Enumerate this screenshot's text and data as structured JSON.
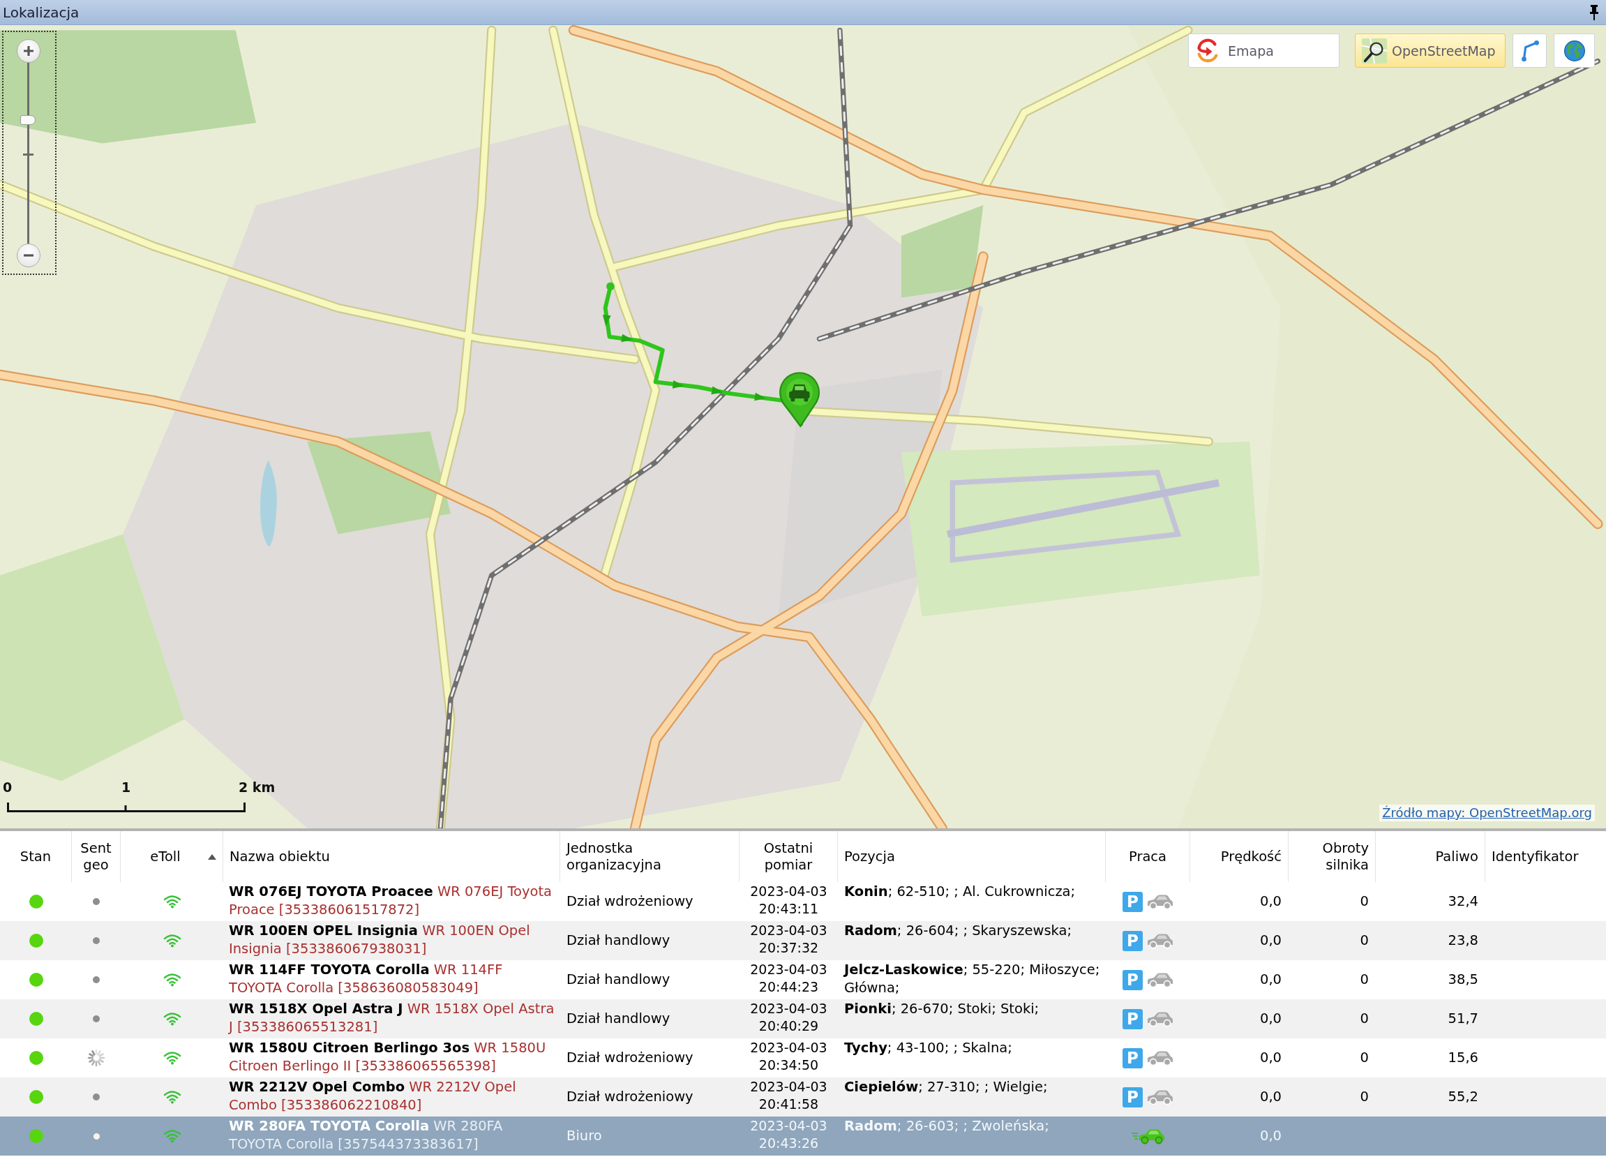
{
  "window": {
    "title": "Lokalizacja"
  },
  "map": {
    "sources": [
      {
        "label": "Emapa",
        "kind": "emapa",
        "selected": false
      },
      {
        "label": "OpenStreetMap",
        "kind": "osm",
        "selected": true
      }
    ],
    "zoom": {
      "level": 0.68
    },
    "scale": [
      "0",
      "1",
      "2 km"
    ],
    "attribution": "Źródło mapy: OpenStreetMap.org"
  },
  "table": {
    "columns": [
      {
        "label": "Stan",
        "sorted": false
      },
      {
        "label": "Sent geo",
        "sorted": false
      },
      {
        "label": "eToll",
        "sorted": true
      },
      {
        "label": "Nazwa obiektu",
        "sorted": false
      },
      {
        "label": "Jednostka organizacyjna",
        "sorted": false
      },
      {
        "label": "Ostatni pomiar",
        "sorted": false
      },
      {
        "label": "Pozycja",
        "sorted": false
      },
      {
        "label": "Praca",
        "sorted": false
      },
      {
        "label": "Prędkość",
        "sorted": false
      },
      {
        "label": "Obroty silnika",
        "sorted": false
      },
      {
        "label": "Paliwo",
        "sorted": false
      },
      {
        "label": "Identyfikator",
        "sorted": false
      }
    ],
    "rows": [
      {
        "online": true,
        "sent_geo": {
          "kind": "dot"
        },
        "etoll": true,
        "name": "**WR 076EJ TOYOTA Proacee** WR 076EJ Toyota Proace [353386061517872]",
        "unit": "Dział wdrożeniowy",
        "last_measurement": "2023-04-03 20:43:11",
        "position": "**Konin**; 62-510; ; Al. Cukrownicza;",
        "work": {
          "kind": "parked",
          "badge": "P"
        },
        "speed": "0,0",
        "rpm": "0",
        "fuel": "32,4",
        "selected": false
      },
      {
        "online": true,
        "sent_geo": {
          "kind": "dot"
        },
        "etoll": true,
        "name": "**WR 100EN OPEL Insignia** WR 100EN Opel Insignia [353386067938031]",
        "unit": "Dział handlowy",
        "last_measurement": "2023-04-03 20:37:32",
        "position": "**Radom**; 26-604; ; Skaryszewska;",
        "work": {
          "kind": "parked",
          "badge": "P"
        },
        "speed": "0,0",
        "rpm": "0",
        "fuel": "23,8",
        "selected": false
      },
      {
        "online": true,
        "sent_geo": {
          "kind": "dot"
        },
        "etoll": true,
        "name": "**WR 114FF TOYOTA Corolla** WR 114FF TOYOTA Corolla [358636080583049]",
        "unit": "Dział handlowy",
        "last_measurement": "2023-04-03 20:44:23",
        "position": "**Jelcz-Laskowice**; 55-220; Miłoszyce; Główna;",
        "work": {
          "kind": "parked",
          "badge": "P"
        },
        "speed": "0,0",
        "rpm": "0",
        "fuel": "38,5",
        "selected": false
      },
      {
        "online": true,
        "sent_geo": {
          "kind": "dot"
        },
        "etoll": true,
        "name": "**WR 1518X Opel Astra J** WR 1518X Opel Astra J [353386065513281]",
        "unit": "Dział handlowy",
        "last_measurement": "2023-04-03 20:40:29",
        "position": "**Pionki**; 26-670; Stoki; Stoki;",
        "work": {
          "kind": "parked",
          "badge": "P"
        },
        "speed": "0,0",
        "rpm": "0",
        "fuel": "51,7",
        "selected": false
      },
      {
        "online": true,
        "sent_geo": {
          "kind": "spinner"
        },
        "etoll": true,
        "name": "**WR 1580U Citroen Berlingo 3os** WR 1580U Citroen Berlingo II [353386065565398]",
        "unit": "Dział wdrożeniowy",
        "last_measurement": "2023-04-03 20:34:50",
        "position": "**Tychy**; 43-100; ; Skalna;",
        "work": {
          "kind": "parked",
          "badge": "P"
        },
        "speed": "0,0",
        "rpm": "0",
        "fuel": "15,6",
        "selected": false
      },
      {
        "online": true,
        "sent_geo": {
          "kind": "dot"
        },
        "etoll": true,
        "name": "**WR 2212V Opel Combo** WR 2212V Opel Combo [353386062210840]",
        "unit": "Dział wdrożeniowy",
        "last_measurement": "2023-04-03 20:41:58",
        "position": "**Ciepielów**; 27-310; ; Wielgie;",
        "work": {
          "kind": "parked",
          "badge": "P"
        },
        "speed": "0,0",
        "rpm": "0",
        "fuel": "55,2",
        "selected": false
      },
      {
        "online": true,
        "sent_geo": {
          "kind": "dot"
        },
        "etoll": true,
        "name": "**WR 280FA TOYOTA Corolla** WR 280FA TOYOTA Corolla [357544373383617]",
        "unit": "Biuro",
        "last_measurement": "2023-04-03 20:43:26",
        "position": "**Radom**; 26-603; ; Zwoleńska;",
        "work": {
          "kind": "driving"
        },
        "speed": "0,0",
        "selected": true
      }
    ]
  }
}
